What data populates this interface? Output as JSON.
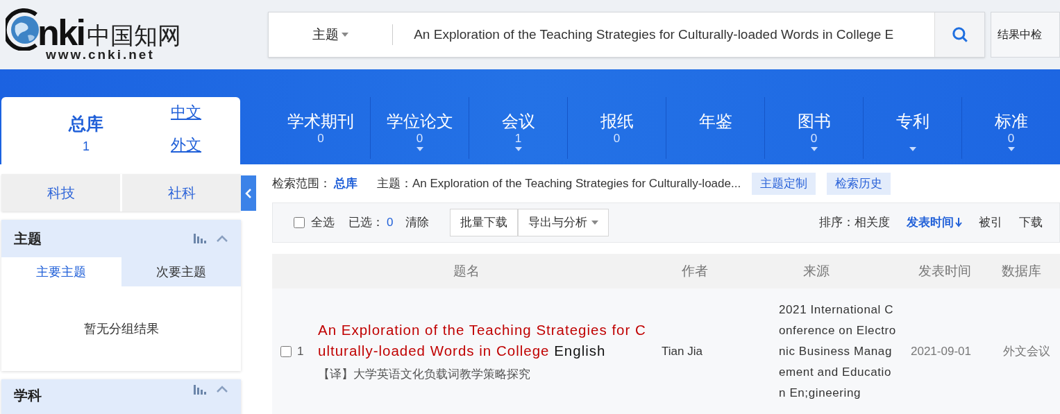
{
  "logo": {
    "mark": "nki",
    "chinese": "中国知网",
    "url": "www.cnki.net"
  },
  "search": {
    "field": "主题",
    "value": "An Exploration of the Teaching Strategies for Culturally-loaded Words in College E",
    "side_button": "结果中检"
  },
  "library_card": {
    "title": "总库",
    "count": "1",
    "links": [
      "中文",
      "外文"
    ]
  },
  "db_tabs": [
    {
      "label": "学术期刊",
      "count": "0",
      "dropdown": false
    },
    {
      "label": "学位论文",
      "count": "0",
      "dropdown": true
    },
    {
      "label": "会议",
      "count": "1",
      "dropdown": true
    },
    {
      "label": "报纸",
      "count": "0",
      "dropdown": false
    },
    {
      "label": "年鉴",
      "dropdown": false
    },
    {
      "label": "图书",
      "count": "0",
      "dropdown": true
    },
    {
      "label": "专利",
      "dropdown": true
    },
    {
      "label": "标准",
      "count": "0",
      "dropdown": true
    }
  ],
  "categories": [
    "科技",
    "社科"
  ],
  "facets": [
    {
      "title": "主题",
      "tabs": [
        {
          "label": "主要主题",
          "selected": true
        },
        {
          "label": "次要主题",
          "selected": false
        }
      ],
      "empty_text": "暂无分组结果"
    },
    {
      "title": "学科"
    }
  ],
  "scope": {
    "label": "检索范围：",
    "value": "总库",
    "query": "主题：An Exploration of the Teaching Strategies for Culturally-loade...",
    "buttons": [
      "主题定制",
      "检索历史"
    ]
  },
  "toolbar": {
    "select_all": {
      "label": "全选",
      "checked": false
    },
    "selected_label": "已选：",
    "selected_count": "0",
    "clear": "清除",
    "buttons": [
      "批量下载",
      "导出与分析"
    ],
    "sort_label": "排序：",
    "sort": [
      {
        "label": "相关度",
        "selected": false
      },
      {
        "label": "发表时间",
        "selected": true
      },
      {
        "label": "被引",
        "selected": false
      },
      {
        "label": "下载",
        "selected": false
      }
    ]
  },
  "table": {
    "columns": [
      "题名",
      "作者",
      "来源",
      "发表时间",
      "数据库"
    ],
    "rows": [
      {
        "checked": false,
        "index": "1",
        "title_highlight": "An Exploration of the Teaching Strategies for Culturally-loaded Words in College",
        "title_rest": "English",
        "translation": "【译】大学英语文化负载词教学策略探究",
        "author": "Tian Jia",
        "source": "2021 International Conference on Electronic Business Management and Education En;gineering",
        "date": "2021-09-01",
        "database": "外文会议"
      }
    ]
  }
}
